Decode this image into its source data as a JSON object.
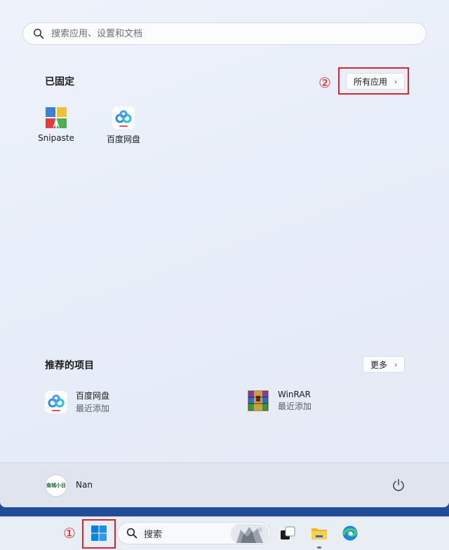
{
  "start_menu": {
    "search": {
      "placeholder": "搜索应用、设置和文档"
    },
    "pinned": {
      "title": "已固定",
      "all_apps_label": "所有应用",
      "all_apps_chevron": "›",
      "annotation": "②",
      "apps": [
        {
          "label": "Snipaste",
          "icon": "snipaste-icon"
        },
        {
          "label": "百度网盘",
          "icon": "baidu-netdisk-icon"
        }
      ]
    },
    "recommended": {
      "title": "推荐的项目",
      "more_label": "更多",
      "more_chevron": "›",
      "items": [
        {
          "name": "百度网盘",
          "sub": "最近添加",
          "icon": "baidu-netdisk-icon"
        },
        {
          "name": "WinRAR",
          "sub": "最近添加",
          "icon": "winrar-icon"
        }
      ]
    },
    "user": {
      "name": "Nan",
      "avatar_text": "南城小目"
    }
  },
  "taskbar": {
    "annotation": "①",
    "search_label": "搜索",
    "icons": [
      "start-icon",
      "task-view-icon",
      "file-explorer-icon",
      "edge-icon"
    ]
  },
  "colors": {
    "annotation_red": "#d8252f",
    "windows_blue": "#0a7fd6",
    "wallpaper": "#2a55a0"
  }
}
